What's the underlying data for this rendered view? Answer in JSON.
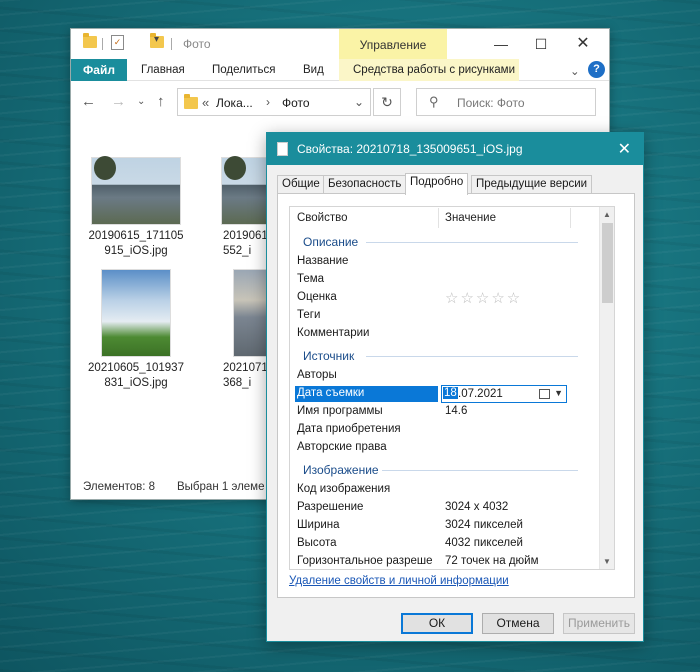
{
  "explorer": {
    "title": "Фото",
    "context_tab": "Управление",
    "ribbon": {
      "file": "Файл",
      "home": "Главная",
      "share": "Поделиться",
      "view": "Вид",
      "picture_tools": "Средства работы с рисунками"
    },
    "address": {
      "crumb1": "Лока...",
      "crumb2": "Фото"
    },
    "search_placeholder": "Поиск: Фото",
    "files": [
      {
        "line1": "20190615_171105",
        "line2": "915_iOS.jpg"
      },
      {
        "line1": "2019061",
        "line2": "552_i"
      },
      {
        "line1": "20210605_101937",
        "line2": "831_iOS.jpg"
      },
      {
        "line1": "2021071",
        "line2": "368_i"
      }
    ],
    "status": {
      "count": "Элементов: 8",
      "selected": "Выбран 1 элеме"
    }
  },
  "dialog": {
    "title": "Свойства: 20210718_135009651_iOS.jpg",
    "tabs": [
      "Общие",
      "Безопасность",
      "Подробно",
      "Предыдущие версии"
    ],
    "col_property": "Свойство",
    "col_value": "Значение",
    "sections": {
      "description": "Описание",
      "source": "Источник",
      "image": "Изображение"
    },
    "description_rows": [
      "Название",
      "Тема",
      "Оценка",
      "Теги",
      "Комментарии"
    ],
    "rating": "☆☆☆☆☆",
    "source_rows": {
      "authors": "Авторы",
      "date_taken": "Дата съемки",
      "date_value_sel": "18",
      "date_value_rest": ".07.2021",
      "program": "Имя программы",
      "program_value": "14.6",
      "acquired": "Дата приобретения",
      "copyright": "Авторские права"
    },
    "image_rows": [
      {
        "k": "Код изображения",
        "v": ""
      },
      {
        "k": "Разрешение",
        "v": "3024 x 4032"
      },
      {
        "k": "Ширина",
        "v": "3024 пикселей"
      },
      {
        "k": "Высота",
        "v": "4032 пикселей"
      },
      {
        "k": "Горизонтальное разреше",
        "v": "72 точек на дюйм"
      }
    ],
    "remove_link": "Удаление свойств и личной информации",
    "buttons": {
      "ok": "ОК",
      "cancel": "Отмена",
      "apply": "Применить"
    }
  }
}
